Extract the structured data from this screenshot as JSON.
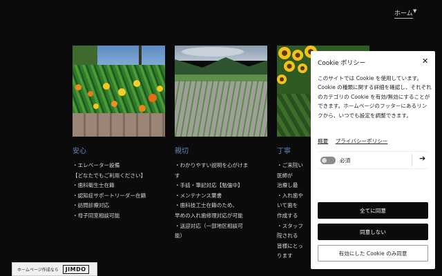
{
  "nav": {
    "home_label": "ホーム",
    "chevron_icon": "chevron-down-icon"
  },
  "columns": [
    {
      "title": "安心",
      "items": [
        "・エレベーター設備",
        "【どなたでもご利用ください】",
        "・歯科衛生士在籍",
        "・認知症サポートリーダー在籍",
        "・訪問診療対応",
        "・母子同室相談可能"
      ]
    },
    {
      "title": "親切",
      "items": [
        "・わかりやすい説明を心がけま",
        "す",
        "・手話・筆記対応【勉強中】",
        "・メンテナンス葉書",
        "・歯科技工士在籍のため、",
        "早めの入れ歯修理対応が可能",
        "・送迎対応（一部地区相談可",
        "能）"
      ]
    },
    {
      "title": "丁寧",
      "items": [
        "・ご来院い",
        "医師が",
        "治療し最",
        "・入れ歯や",
        "いて歯を",
        "作成する",
        "・スタッフ",
        "院される",
        "皆様にとっ",
        "ります"
      ]
    }
  ],
  "badge": {
    "text": "ホームページ作成なら",
    "logo": "JIMDO"
  },
  "cookie": {
    "title": "Cookie ポリシー",
    "body": "このサイトでは Cookie を使用しています。Cookie の種類に関する詳細を確認し、それぞれのカテゴリの Cookie を有効/無効にすることができます。ホームページのフッターにあるリンクから、いつでも設定を調整できます。",
    "link_overview": "概要",
    "link_privacy": "プライバシーポリシー",
    "required_label": "必須",
    "accept_all": "全てに同意",
    "decline": "同意しない",
    "accept_enabled": "有効にした Cookie のみ同意"
  }
}
